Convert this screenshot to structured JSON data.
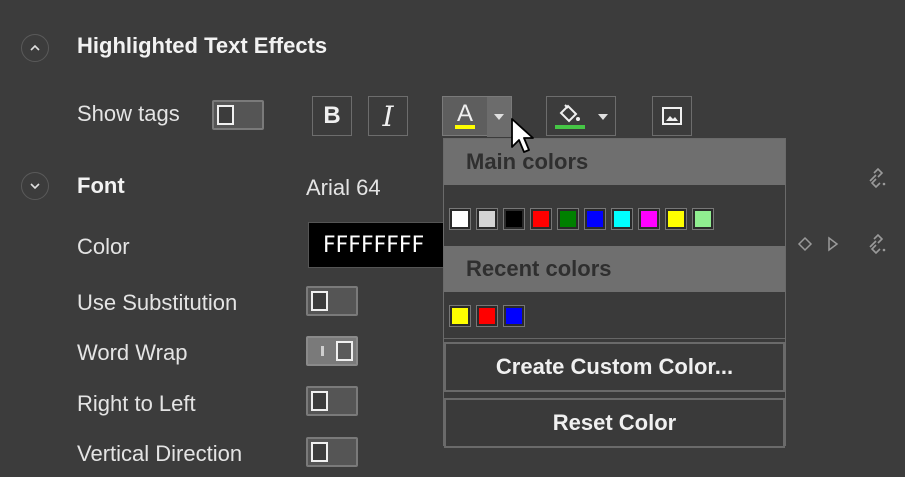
{
  "section_effects": {
    "title": "Highlighted Text Effects",
    "show_tags_label": "Show tags",
    "toolbar": {
      "bold_label": "B",
      "italic_label": "I",
      "text_color_glyph": "A",
      "text_color_accent": "#ffff00",
      "fill_color_accent": "#46c646"
    }
  },
  "section_font": {
    "title": "Font",
    "font_value": "Arial 64",
    "color_label": "Color",
    "color_value": "FFFFFFFF",
    "rows": [
      {
        "label": "Use Substitution",
        "state": "off"
      },
      {
        "label": "Word Wrap",
        "state": "partial"
      },
      {
        "label": "Right to Left",
        "state": "off"
      },
      {
        "label": "Vertical Direction",
        "state": "off"
      }
    ]
  },
  "color_dropdown": {
    "main_colors_label": "Main colors",
    "main_colors": [
      "#ffffff",
      "#d4d4d4",
      "#000000",
      "#ff0000",
      "#008000",
      "#0000ff",
      "#00ffff",
      "#ff00ff",
      "#ffff00",
      "#90ee90"
    ],
    "recent_colors_label": "Recent colors",
    "recent_colors": [
      "#ffff00",
      "#ff0000",
      "#0000ff"
    ],
    "create_custom_label": "Create Custom Color...",
    "reset_label": "Reset Color"
  }
}
